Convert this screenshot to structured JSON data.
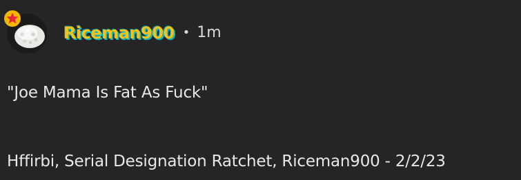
{
  "post": {
    "author": {
      "username": "Riceman900",
      "avatar_icon": "rice-bowl-avatar",
      "badge_icon": "star-badge-icon",
      "username_color": "#f2c21f",
      "username_shadow_color": "#14b8b8"
    },
    "separator": "•",
    "timestamp": "1m",
    "quote": "\"Joe Mama Is Fat As Fuck\"",
    "credits": "Hffirbi, Serial Designation Ratchet, Riceman900 - 2/2/23"
  }
}
